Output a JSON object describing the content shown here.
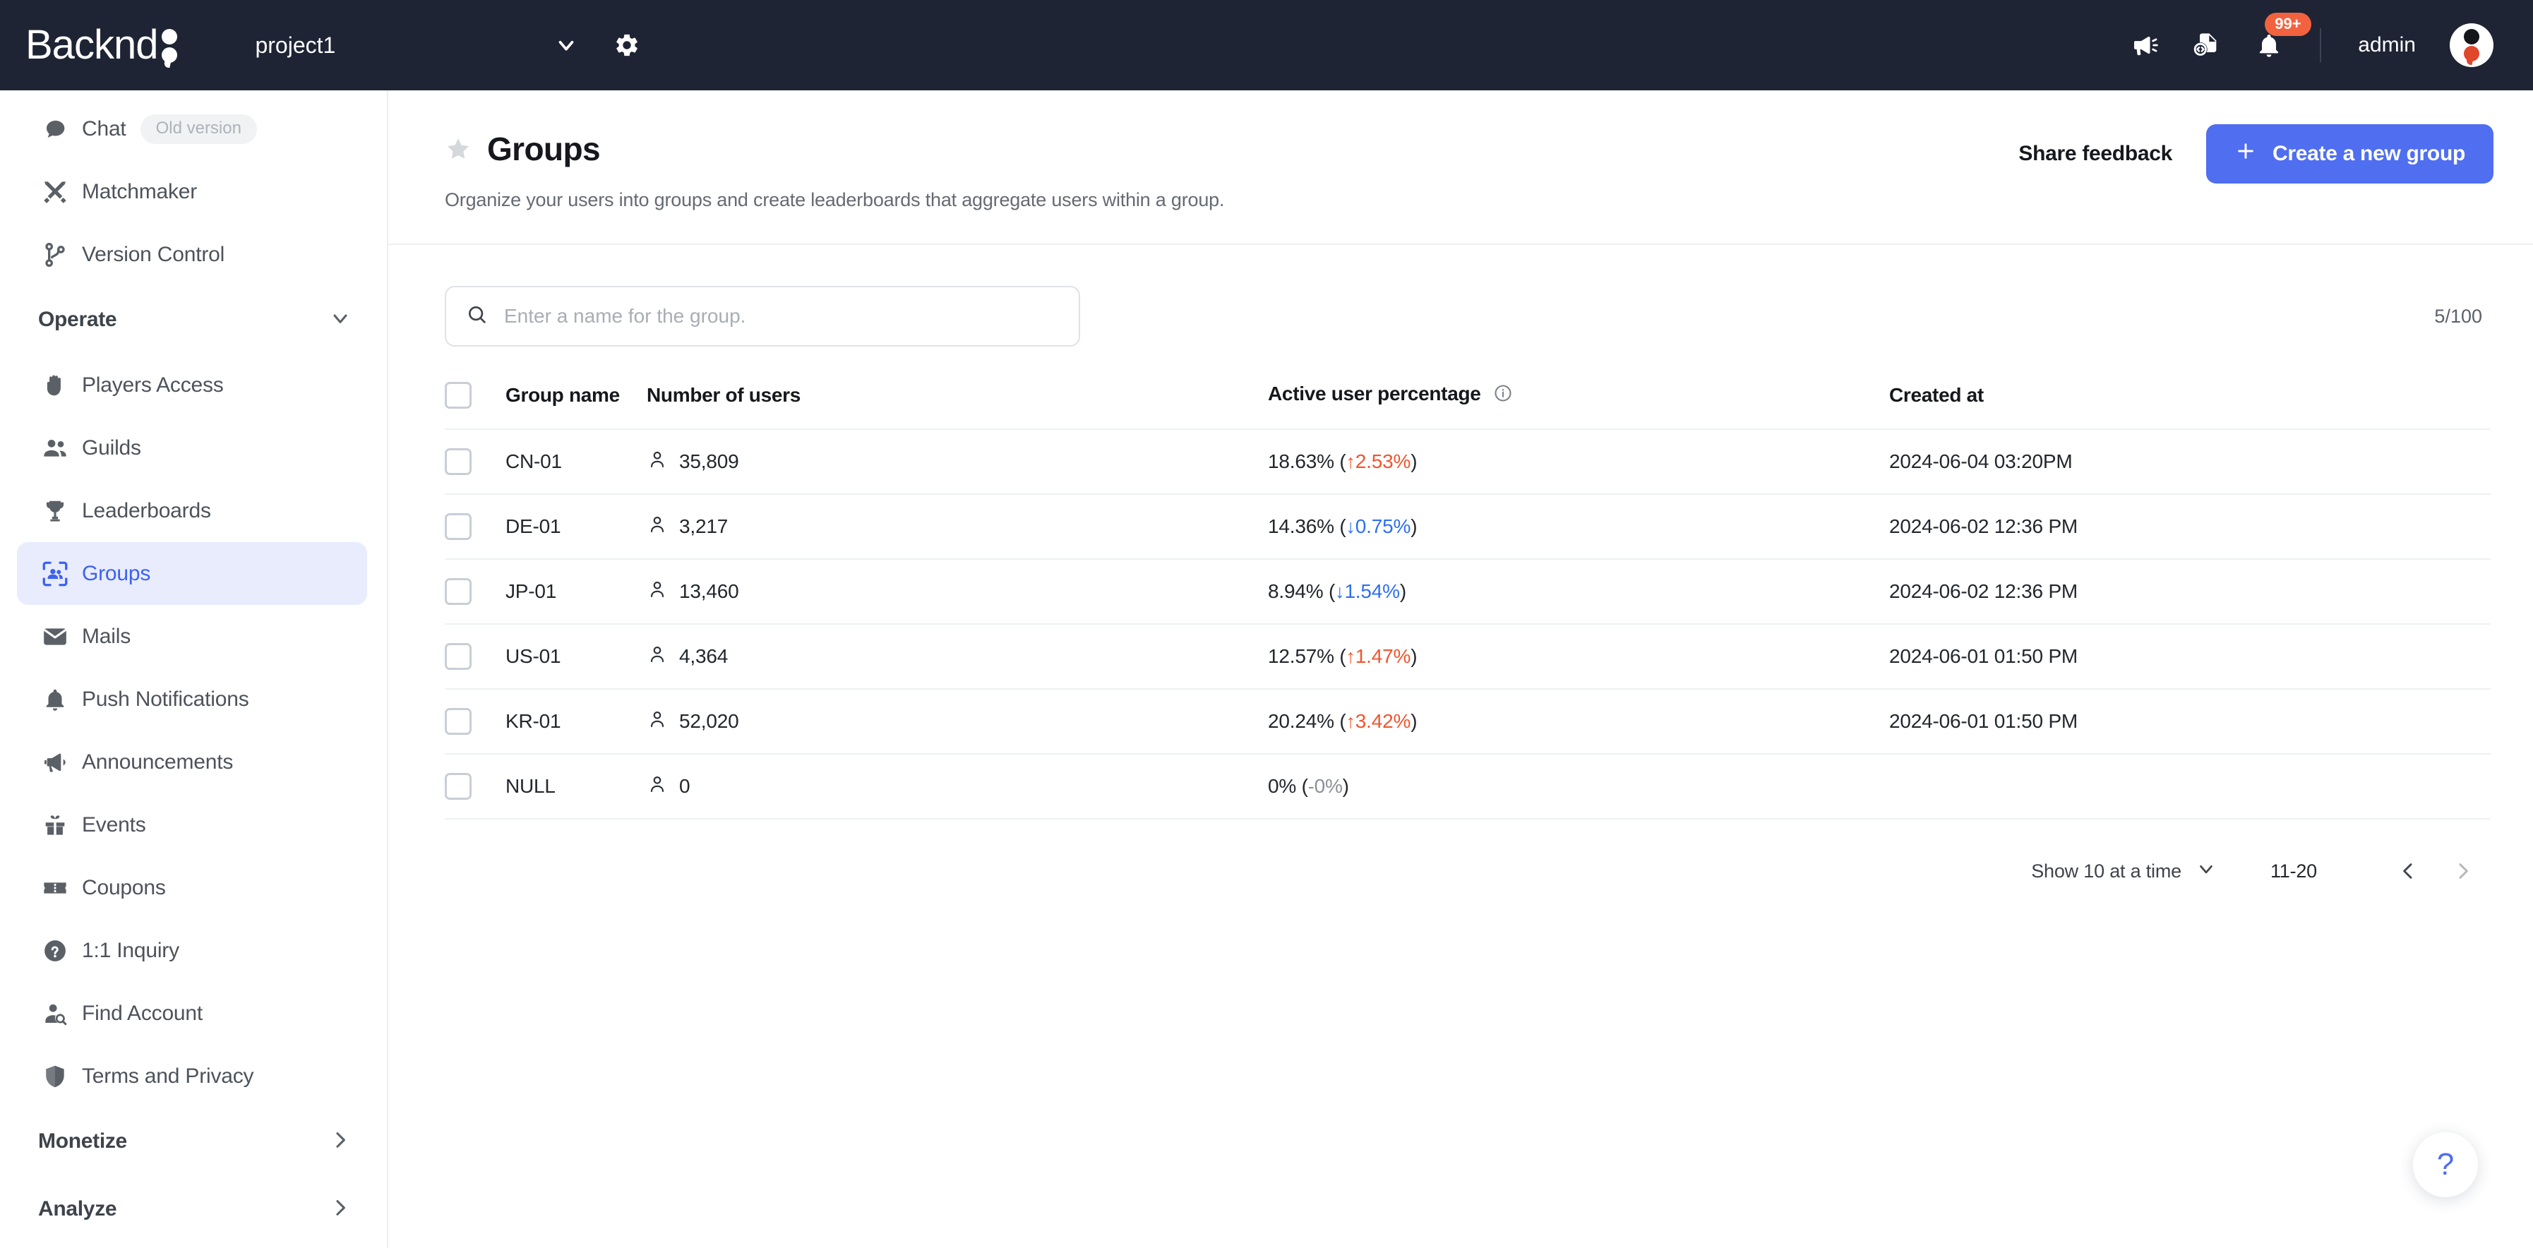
{
  "topbar": {
    "logo_text": "Backnd",
    "project_name": "project1",
    "notification_badge": "99+",
    "admin_label": "admin"
  },
  "sidebar": {
    "items": [
      {
        "label": "Chat",
        "icon": "chat-bubble-icon",
        "badge": "Old version",
        "active": false
      },
      {
        "label": "Matchmaker",
        "icon": "crossed-swords-icon",
        "badge": "",
        "active": false
      },
      {
        "label": "Version Control",
        "icon": "git-branch-icon",
        "badge": "",
        "active": false
      }
    ],
    "operate_section": {
      "title": "Operate",
      "expanded": true,
      "items": [
        {
          "label": "Players Access",
          "icon": "hand-icon",
          "active": false
        },
        {
          "label": "Guilds",
          "icon": "people-icon",
          "active": false
        },
        {
          "label": "Leaderboards",
          "icon": "trophy-icon",
          "active": false
        },
        {
          "label": "Groups",
          "icon": "groups-frame-icon",
          "active": true
        },
        {
          "label": "Mails",
          "icon": "envelope-icon",
          "active": false
        },
        {
          "label": "Push Notifications",
          "icon": "bell-icon",
          "active": false
        },
        {
          "label": "Announcements",
          "icon": "megaphone-icon",
          "active": false
        },
        {
          "label": "Events",
          "icon": "gift-icon",
          "active": false
        },
        {
          "label": "Coupons",
          "icon": "ticket-icon",
          "active": false
        },
        {
          "label": "1:1 Inquiry",
          "icon": "question-circle-icon",
          "active": false
        },
        {
          "label": "Find Account",
          "icon": "user-search-icon",
          "active": false
        },
        {
          "label": "Terms and Privacy",
          "icon": "shield-icon",
          "active": false
        }
      ]
    },
    "collapsed_sections": [
      {
        "title": "Monetize"
      },
      {
        "title": "Analyze"
      }
    ]
  },
  "page": {
    "title": "Groups",
    "subtitle": "Organize your users into groups and create leaderboards that aggregate users within a group.",
    "share_feedback_label": "Share feedback",
    "create_button_label": "Create a new group"
  },
  "search": {
    "placeholder": "Enter a name for the group.",
    "value": "",
    "count": "5/100"
  },
  "table": {
    "headers": {
      "group_name": "Group name",
      "number_of_users": "Number of users",
      "active_user_percentage": "Active user percentage",
      "created_at": "Created at"
    },
    "rows": [
      {
        "name": "CN-01",
        "users": "35,809",
        "pct": "18.63%",
        "delta_arrow": "↑",
        "delta": "2.53%",
        "dir": "up",
        "created": "2024-06-04 03:20PM"
      },
      {
        "name": "DE-01",
        "users": "3,217",
        "pct": "14.36%",
        "delta_arrow": "↓",
        "delta": "0.75%",
        "dir": "down",
        "created": "2024-06-02 12:36 PM"
      },
      {
        "name": "JP-01",
        "users": "13,460",
        "pct": "8.94%",
        "delta_arrow": "↓",
        "delta": "1.54%",
        "dir": "down",
        "created": "2024-06-02 12:36 PM"
      },
      {
        "name": "US-01",
        "users": "4,364",
        "pct": "12.57%",
        "delta_arrow": "↑",
        "delta": "1.47%",
        "dir": "up",
        "created": "2024-06-01 01:50  PM"
      },
      {
        "name": "KR-01",
        "users": "52,020",
        "pct": "20.24%",
        "delta_arrow": "↑",
        "delta": "3.42%",
        "dir": "up",
        "created": "2024-06-01 01:50  PM"
      },
      {
        "name": "NULL",
        "users": "0",
        "pct": "0%",
        "delta_arrow": "-",
        "delta": "0%",
        "dir": "none",
        "created": ""
      }
    ]
  },
  "pagination": {
    "per_page_label": "Show 10 at a time",
    "range": "11-20"
  },
  "help": {
    "glyph": "?"
  },
  "colors": {
    "accent_blue": "#4f6ef0",
    "active_nav_blue": "#3d61f0",
    "active_nav_bg": "#e8ecfd",
    "up_red": "#f0552f",
    "down_blue": "#2f6ff0",
    "topbar_bg": "#1e2434",
    "badge_orange": "#f2623f"
  }
}
